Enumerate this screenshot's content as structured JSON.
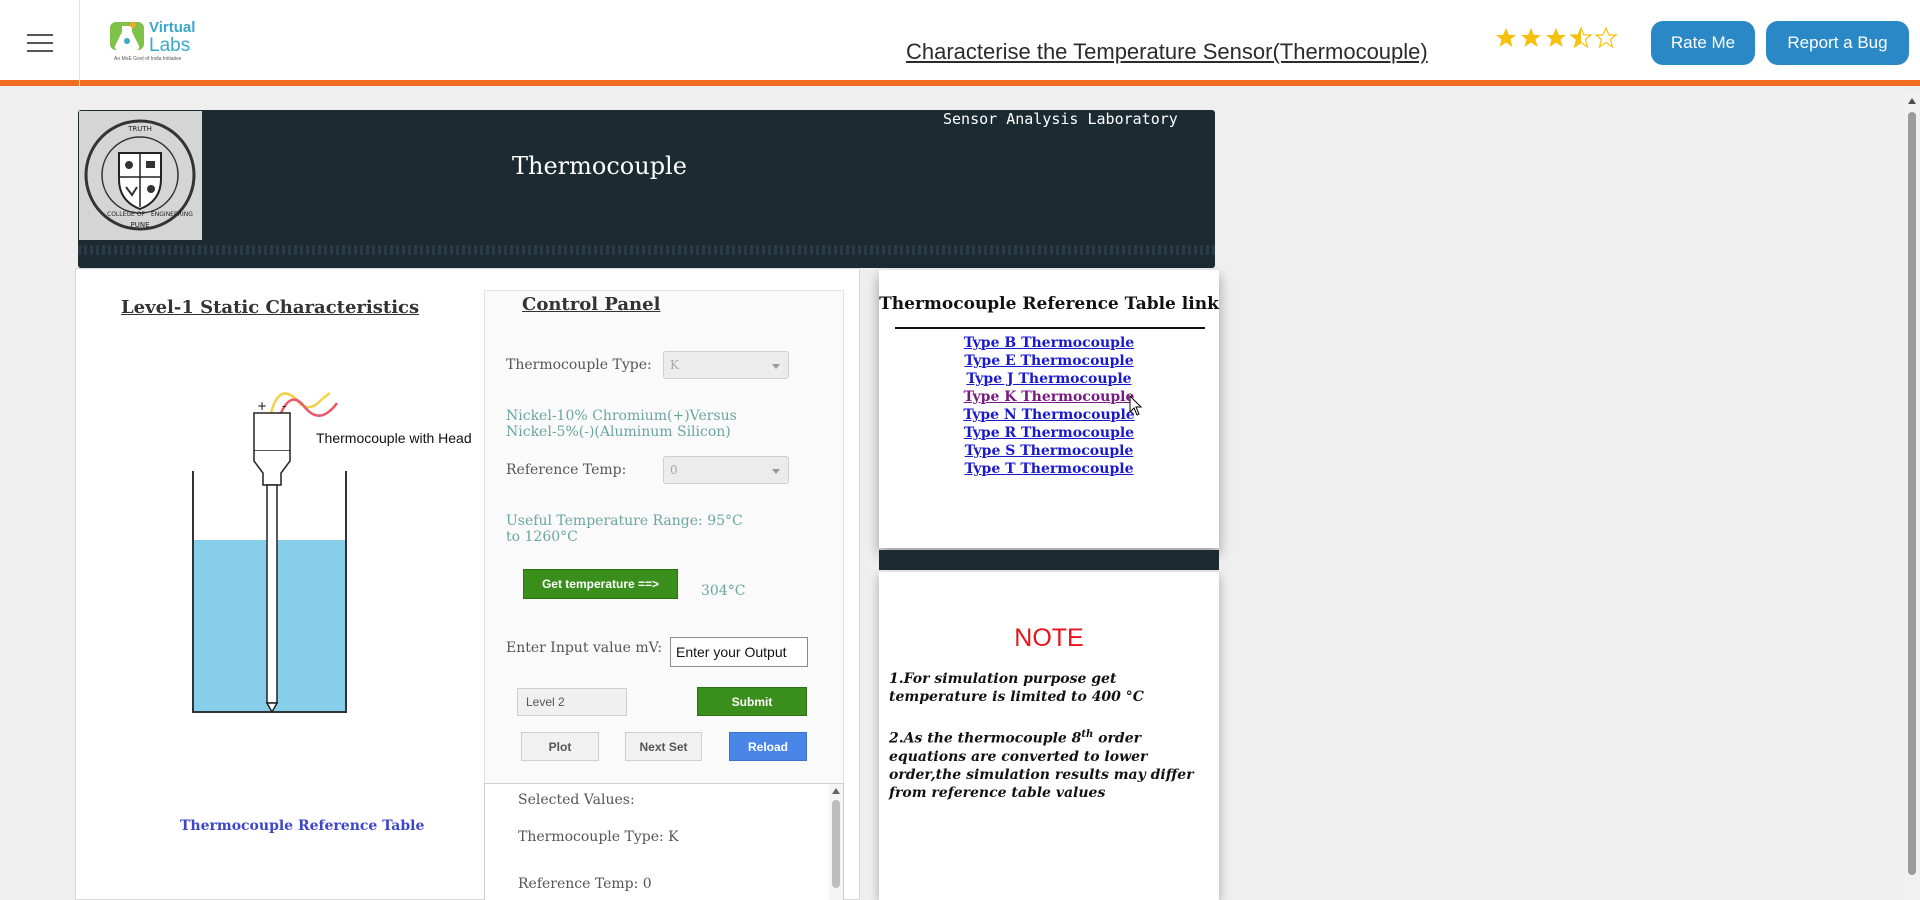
{
  "header": {
    "logo": {
      "line1": "Virtual",
      "line2": "Labs",
      "tagline": "An MoE Govt of India Initiative"
    },
    "title": "Characterise the Temperature Sensor(Thermocouple)",
    "rating": 3.5,
    "rate_button": "Rate Me",
    "bug_button": "Report a Bug"
  },
  "lab": {
    "name": "Sensor Analysis Laboratory",
    "experiment_title": "Thermocouple",
    "crest": {
      "top": "TRUTH",
      "bottom": "PUNE",
      "left": "COLLEGE OF",
      "right": "ENGINEERING"
    }
  },
  "diagram": {
    "level_title": "Level-1 Static Characteristics",
    "head_label": "Thermocouple with Head",
    "plus": "+",
    "minus": "-",
    "reference_table_link": "Thermocouple Reference Table"
  },
  "control_panel": {
    "title": "Control Panel",
    "type_label": "Thermocouple Type:",
    "type_value": "K",
    "type_description_1": "Nickel-10% Chromium(+)Versus",
    "type_description_2": "Nickel-5%(-)(Aluminum Silicon)",
    "ref_temp_label": "Reference Temp:",
    "ref_temp_value": "0",
    "range_1": "Useful Temperature Range: 95°C",
    "range_2": "to 1260°C",
    "get_temp_button": "Get temperature ==>",
    "temperature_readout": "304°C",
    "input_label": "Enter Input value mV:",
    "input_value": "Enter your Output",
    "level_field": "Level 2",
    "submit_button": "Submit",
    "plot_button": "Plot",
    "next_set_button": "Next Set",
    "reload_button": "Reload",
    "selected_values": {
      "heading": "Selected Values:",
      "type": "Thermocouple Type: K",
      "ref_temp": "Reference Temp: 0"
    }
  },
  "reference_panel": {
    "title": "Thermocouple Reference Table link",
    "links": [
      "Type B Thermocouple",
      "Type E Thermocouple",
      "Type J Thermocouple",
      "Type K Thermocouple",
      "Type N Thermocouple",
      "Type R Thermocouple",
      "Type S Thermocouple",
      "Type T Thermocouple"
    ]
  },
  "note_panel": {
    "title": "NOTE",
    "note1": "1.For simulation purpose get temperature is limited to 400 °C",
    "note2_before": "2.As the thermocouple 8",
    "note2_sup": "th",
    "note2_after": " order equations are converted to lower order,the simulation results may differ from reference table values"
  },
  "colors": {
    "accent_orange": "#f26c1f",
    "header_blue": "#2a88c6",
    "lab_dark": "#1c2a31",
    "green_button": "#3a8f1c",
    "blue_button": "#4a86e8",
    "note_red": "#e8141c",
    "link_blue": "#1a1acc",
    "teal_text": "#6aa6a0"
  }
}
